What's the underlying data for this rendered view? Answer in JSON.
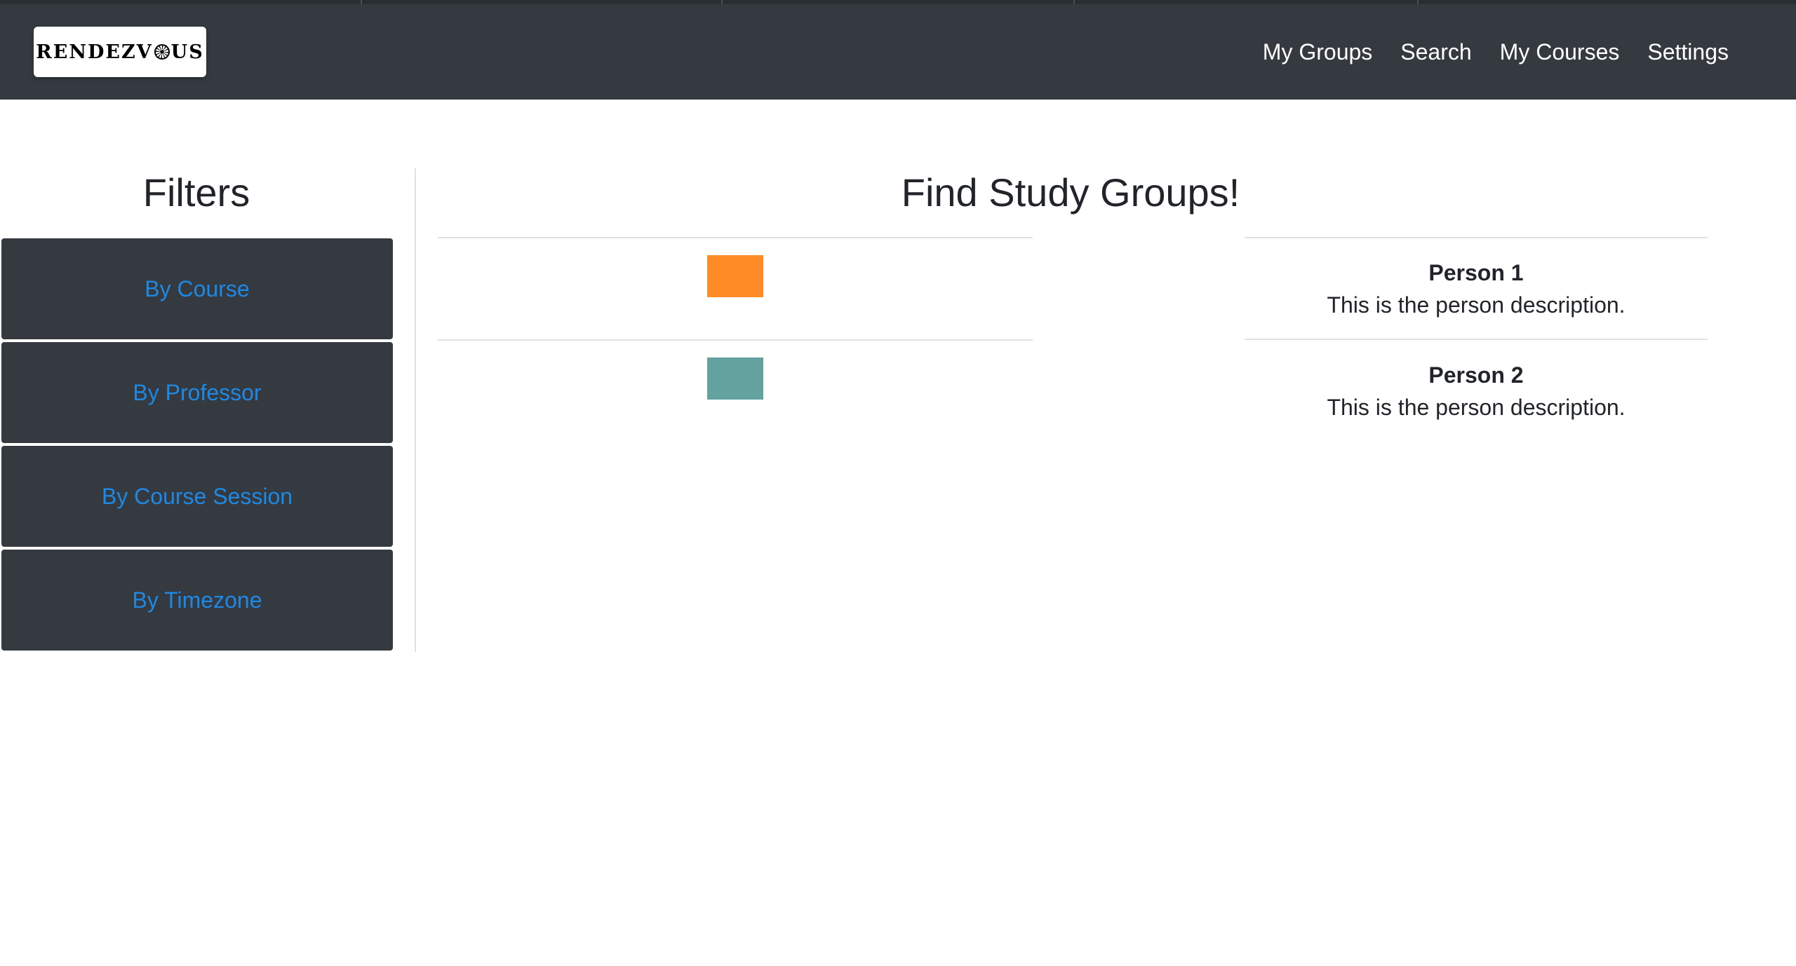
{
  "brand": {
    "logo_text": "RENDEZVOUS"
  },
  "nav": {
    "links": [
      "My Groups",
      "Search",
      "My Courses",
      "Settings"
    ]
  },
  "sidebar": {
    "title": "Filters",
    "filters": [
      "By Course",
      "By Professor",
      "By Course Session",
      "By Timezone"
    ]
  },
  "main": {
    "title": "Find Study Groups!",
    "people": [
      {
        "name": "Person 1",
        "description": "This is the person description.",
        "thumb_color": "#ff8c26"
      },
      {
        "name": "Person 2",
        "description": "This is the person description.",
        "thumb_color": "#63a29f"
      }
    ]
  },
  "colors": {
    "navbar": "#343a40",
    "filter_bg": "#343a40",
    "filter_link": "#1e88e5"
  }
}
